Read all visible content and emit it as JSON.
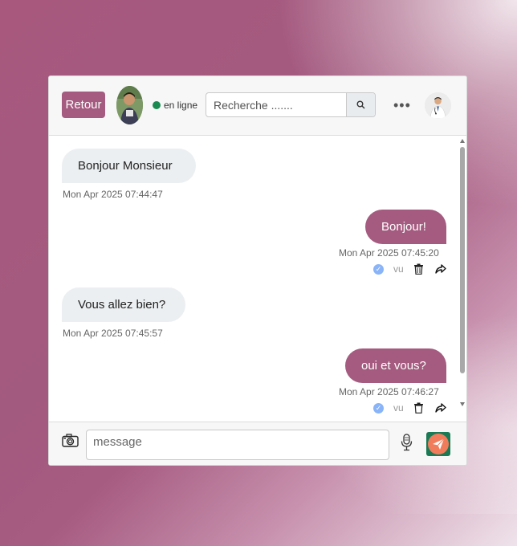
{
  "header": {
    "back_label": "Retour",
    "status_label": "en ligne",
    "search_placeholder": "Recherche .......",
    "more_label": "•••"
  },
  "messages": [
    {
      "direction": "incoming",
      "text": "Bonjour Monsieur",
      "time": "Mon Apr 2025 07:44:47"
    },
    {
      "direction": "outgoing",
      "text": "Bonjour!",
      "time": "Mon Apr 2025 07:45:20",
      "seen_label": "vu"
    },
    {
      "direction": "incoming",
      "text": "Vous allez bien?",
      "time": "Mon Apr 2025 07:45:57"
    },
    {
      "direction": "outgoing",
      "text": "oui et vous?",
      "time": "Mon Apr 2025 07:46:27",
      "seen_label": "vu"
    }
  ],
  "footer": {
    "message_placeholder": "message"
  },
  "colors": {
    "accent": "#a45b7f",
    "online": "#1a8a50",
    "send_bg": "#1a7a55",
    "send_circle": "#f07c5c",
    "seen_check": "#8ab4f8"
  },
  "icons": [
    "camera-icon",
    "microphone-icon",
    "send-icon",
    "search-icon",
    "trash-icon",
    "share-icon",
    "check-icon",
    "more-icon"
  ]
}
